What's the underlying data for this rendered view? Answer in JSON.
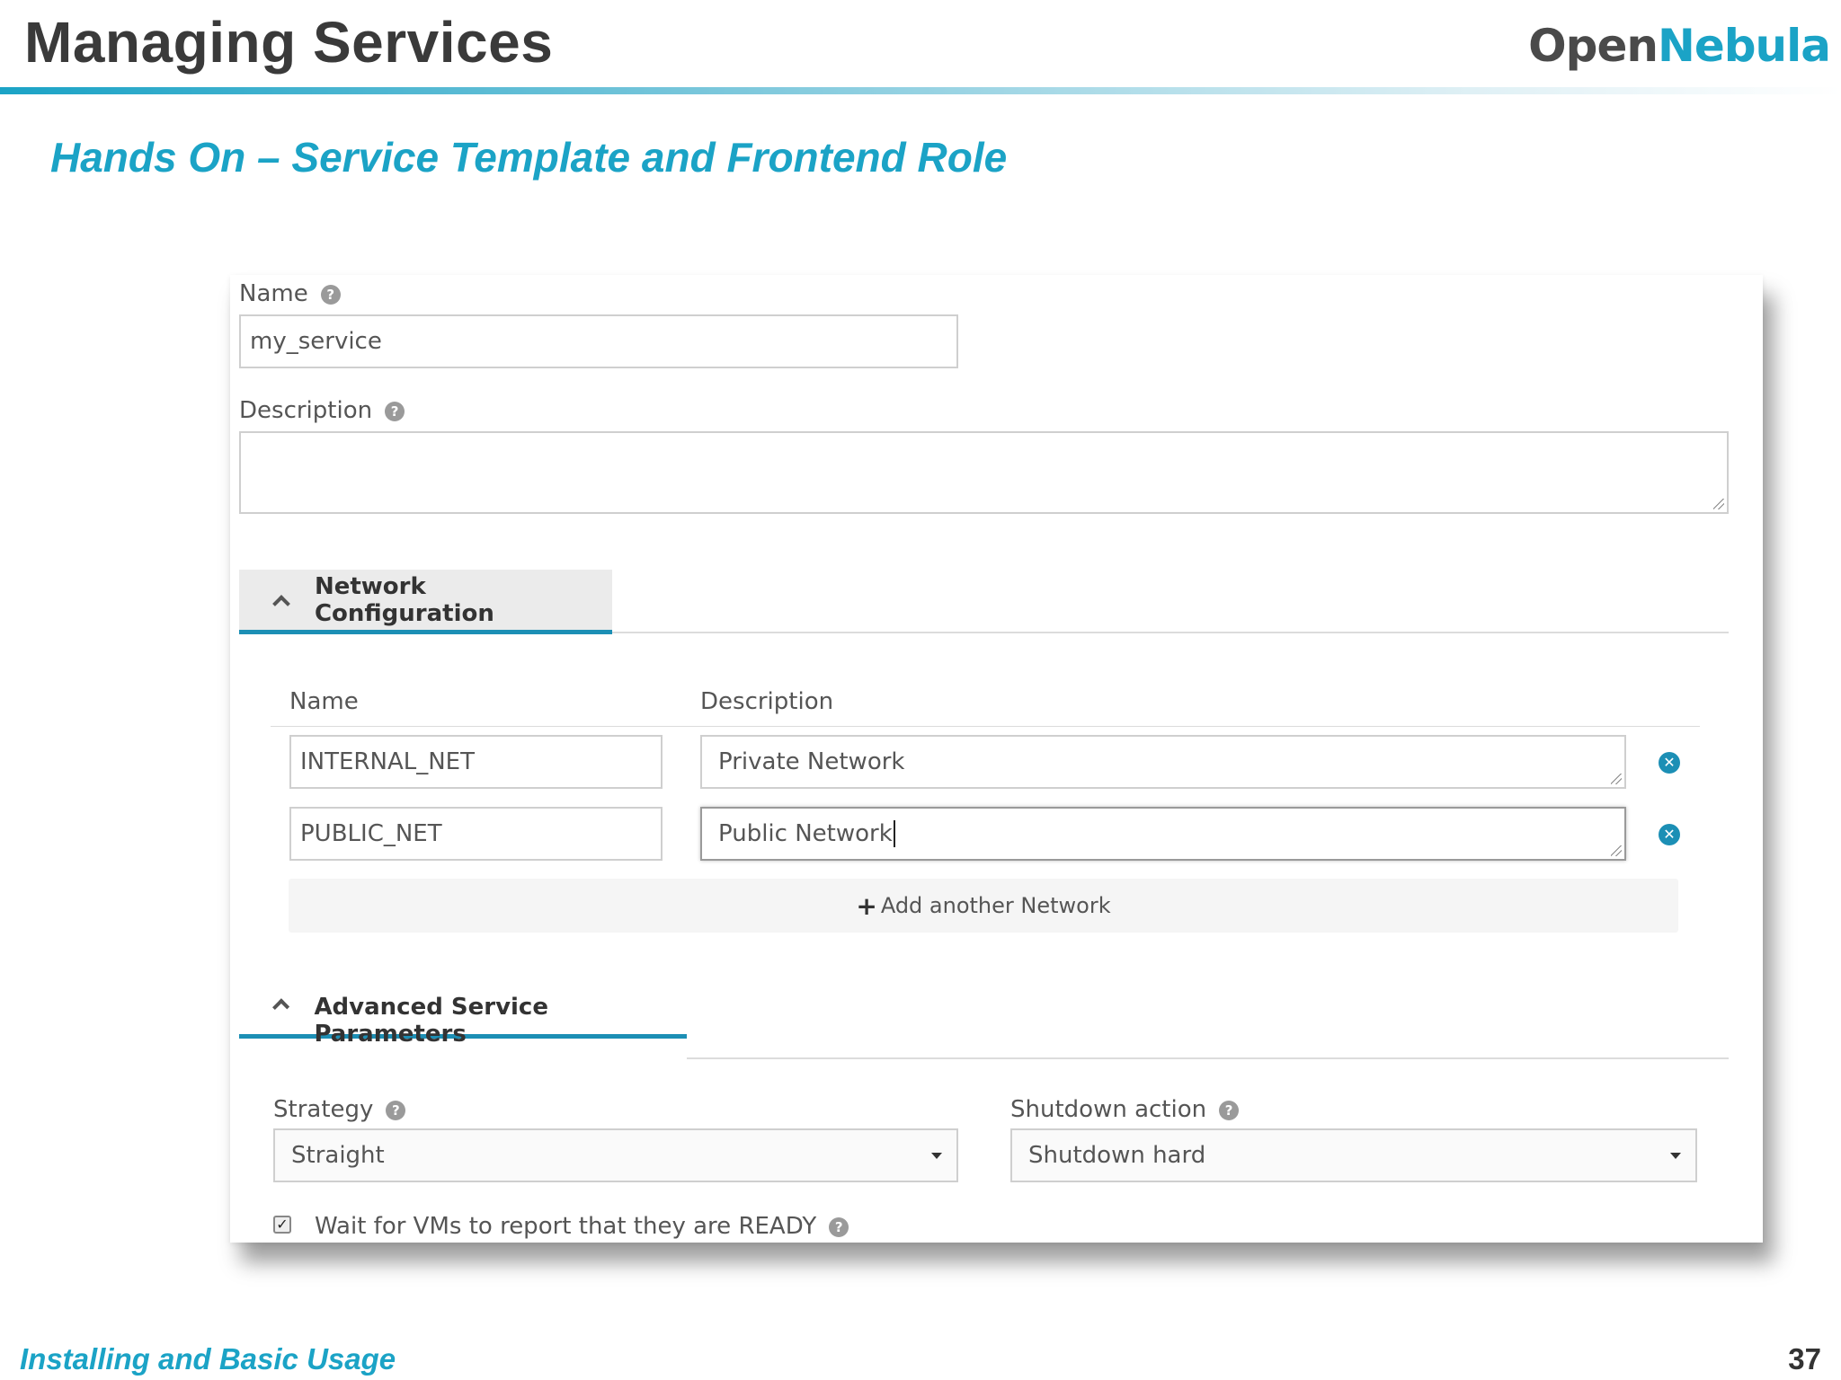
{
  "slide": {
    "title": "Managing Services",
    "logo_part1": "Open",
    "logo_part2": "Nebula",
    "subtitle": "Hands On – Service Template and Frontend Role",
    "footer": "Installing and Basic Usage",
    "page_number": "37"
  },
  "form": {
    "name_label": "Name",
    "name_value": "my_service",
    "description_label": "Description",
    "description_value": ""
  },
  "network_section": {
    "title": "Network Configuration",
    "col_name": "Name",
    "col_description": "Description",
    "rows": [
      {
        "name": "INTERNAL_NET",
        "description": "Private Network"
      },
      {
        "name": "PUBLIC_NET",
        "description": "Public Network"
      }
    ],
    "add_label": "Add another Network"
  },
  "advanced_section": {
    "title": "Advanced Service Parameters",
    "strategy_label": "Strategy",
    "strategy_value": "Straight",
    "shutdown_label": "Shutdown action",
    "shutdown_value": "Shutdown hard",
    "ready_label": "Wait for VMs to report that they are READY",
    "ready_checked": true
  },
  "colors": {
    "accent": "#1ba3c6",
    "tab_underline": "#1c8fb5"
  },
  "icons": {
    "help": "question-circle-icon",
    "remove": "times-circle-icon",
    "add": "plus-icon",
    "collapse": "chevron-up-icon",
    "dropdown": "caret-down-icon"
  }
}
